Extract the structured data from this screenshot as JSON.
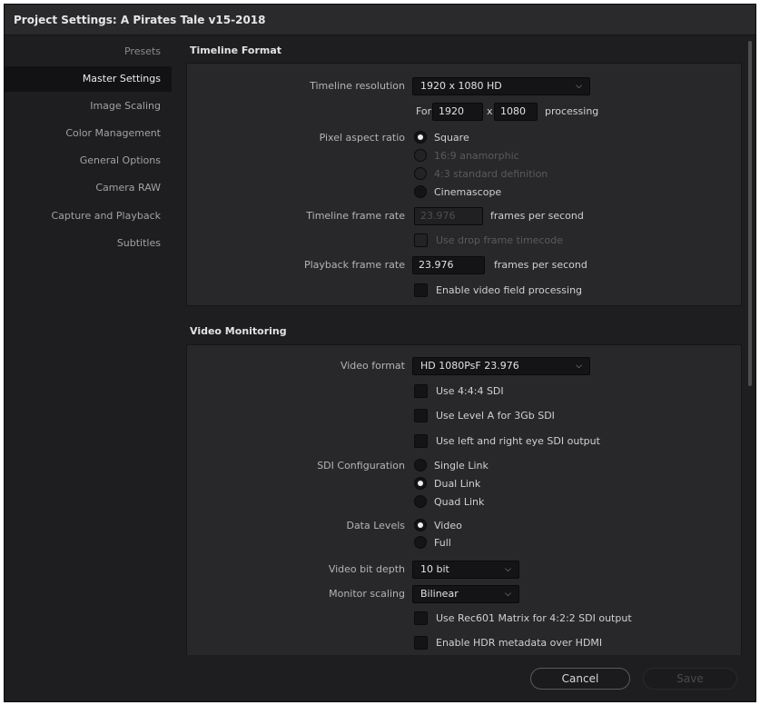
{
  "window": {
    "title": "Project Settings:  A Pirates Tale v15-2018"
  },
  "sidebar": {
    "items": [
      {
        "label": "Presets"
      },
      {
        "label": "Master Settings"
      },
      {
        "label": "Image Scaling"
      },
      {
        "label": "Color Management"
      },
      {
        "label": "General Options"
      },
      {
        "label": "Camera RAW"
      },
      {
        "label": "Capture and Playback"
      },
      {
        "label": "Subtitles"
      }
    ],
    "active_index": 1
  },
  "timeline_format": {
    "heading": "Timeline Format",
    "resolution_label": "Timeline resolution",
    "resolution_value": "1920 x 1080 HD",
    "for_label": "For",
    "width_value": "1920",
    "x_label": "x",
    "height_value": "1080",
    "processing_label": "processing",
    "pixel_aspect_label": "Pixel aspect ratio",
    "aspect_options": [
      {
        "label": "Square",
        "selected": true,
        "enabled": true
      },
      {
        "label": "16:9 anamorphic",
        "selected": false,
        "enabled": false
      },
      {
        "label": "4:3 standard definition",
        "selected": false,
        "enabled": false
      },
      {
        "label": "Cinemascope",
        "selected": false,
        "enabled": true
      }
    ],
    "frame_rate_label": "Timeline frame rate",
    "frame_rate_value": "23.976",
    "frames_per_second": "frames per second",
    "drop_frame_label": "Use drop frame timecode",
    "playback_label": "Playback frame rate",
    "playback_value": "23.976",
    "field_processing_label": "Enable video field processing"
  },
  "video_monitoring": {
    "heading": "Video Monitoring",
    "format_label": "Video format",
    "format_value": "HD 1080PsF 23.976",
    "use_444_label": "Use 4:4:4 SDI",
    "level_a_label": "Use Level A for 3Gb SDI",
    "left_right_label": "Use left and right eye SDI output",
    "sdi_config_label": "SDI Configuration",
    "sdi_options": [
      {
        "label": "Single Link",
        "selected": false
      },
      {
        "label": "Dual Link",
        "selected": true
      },
      {
        "label": "Quad Link",
        "selected": false
      }
    ],
    "data_levels_label": "Data Levels",
    "data_levels_options": [
      {
        "label": "Video",
        "selected": true
      },
      {
        "label": "Full",
        "selected": false
      }
    ],
    "bit_depth_label": "Video bit depth",
    "bit_depth_value": "10 bit",
    "monitor_scaling_label": "Monitor scaling",
    "monitor_scaling_value": "Bilinear",
    "rec601_label": "Use Rec601 Matrix for 4:2:2 SDI output",
    "hdr_label": "Enable HDR metadata over HDMI"
  },
  "footer": {
    "cancel_label": "Cancel",
    "save_label": "Save"
  },
  "icons": {
    "dropdown": "chevron-down-icon"
  }
}
